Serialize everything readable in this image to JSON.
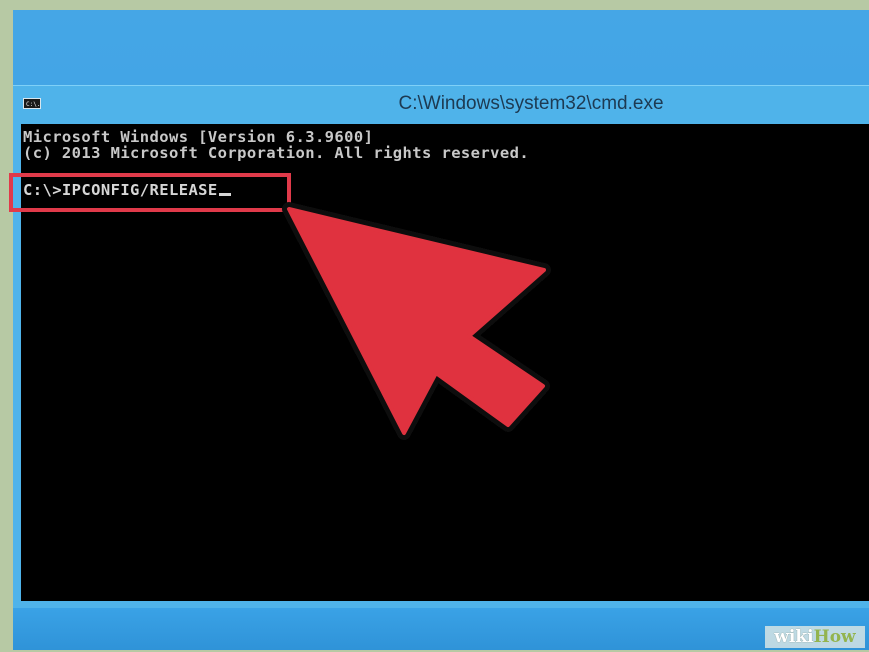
{
  "window": {
    "title": "C:\\Windows\\system32\\cmd.exe",
    "icon_label": "C:\\."
  },
  "console": {
    "line1": "Microsoft Windows [Version 6.3.9600]",
    "line2": "(c) 2013 Microsoft Corporation. All rights reserved.",
    "prompt": "C:\\>IPCONFIG/RELEASE"
  },
  "watermark": {
    "part1": "wiki",
    "part2": "How"
  },
  "colors": {
    "highlight": "#e03a4a",
    "arrow_fill": "#e0323f",
    "console_bg": "#000000",
    "window_chrome": "#4fb3ea"
  },
  "icons": {
    "app": "cmd-icon",
    "pointer": "arrow-pointer-icon"
  }
}
